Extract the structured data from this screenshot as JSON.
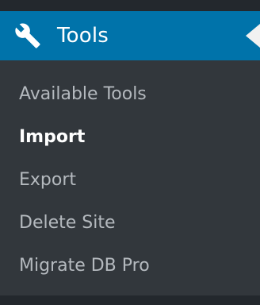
{
  "menu": {
    "title": "Tools",
    "icon": "wrench-icon",
    "colors": {
      "header_bg": "#0073aa",
      "submenu_bg": "#32373c",
      "sidebar_bg": "#23282d",
      "text": "#b4b9be",
      "current_text": "#ffffff"
    }
  },
  "submenu": {
    "items": [
      {
        "label": "Available Tools"
      },
      {
        "label": "Import",
        "current": true
      },
      {
        "label": "Export"
      },
      {
        "label": "Delete Site"
      },
      {
        "label": "Migrate DB Pro"
      }
    ]
  }
}
